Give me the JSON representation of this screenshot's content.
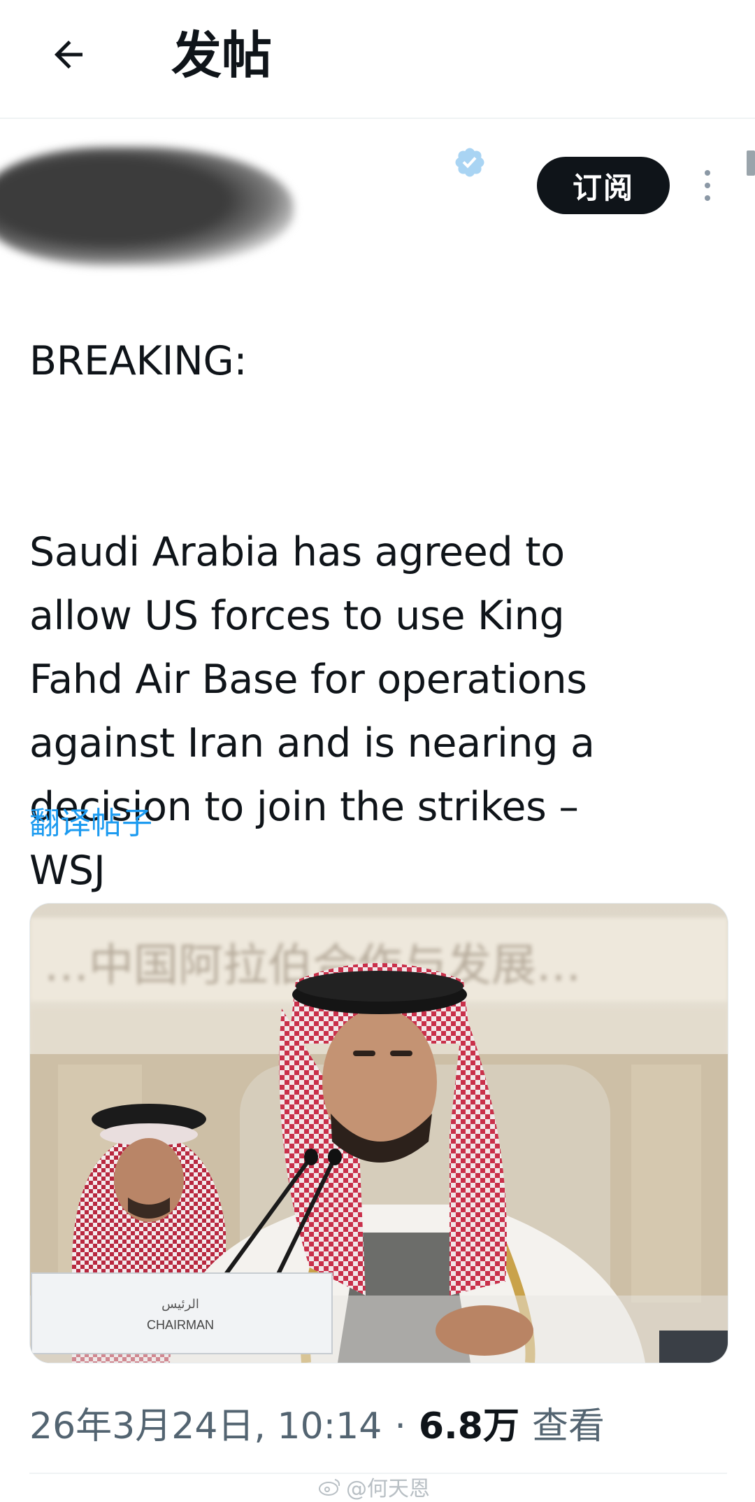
{
  "header": {
    "title": "发帖"
  },
  "author": {
    "subscribe_label": "订阅"
  },
  "tweet": {
    "headline": "BREAKING:",
    "body": "Saudi Arabia has agreed to\nallow US forces to use King\nFahd Air Base for operations\nagainst Iran and is nearing a\ndecision to join the strikes –\nWSJ",
    "translate_label": "翻译帖子"
  },
  "photo": {
    "banner_text": "…中国阿拉伯合作与发展…",
    "placard_arabic": "الرئيس",
    "placard_label": "CHAIRMAN"
  },
  "meta": {
    "date_time": "26年3月24日, 10:14",
    "separator": "·",
    "views_count": "6.8万",
    "views_label": "查看"
  },
  "watermark": {
    "text": "@何天恩"
  },
  "colors": {
    "accent": "#1d9bf0",
    "text_primary": "#0f1419",
    "text_secondary": "#536471",
    "button_dark": "#0f1419"
  },
  "icons": {
    "back": "arrow-left-icon",
    "verified": "verified-badge-icon",
    "more": "more-vertical-icon",
    "watermark": "weibo-icon"
  }
}
